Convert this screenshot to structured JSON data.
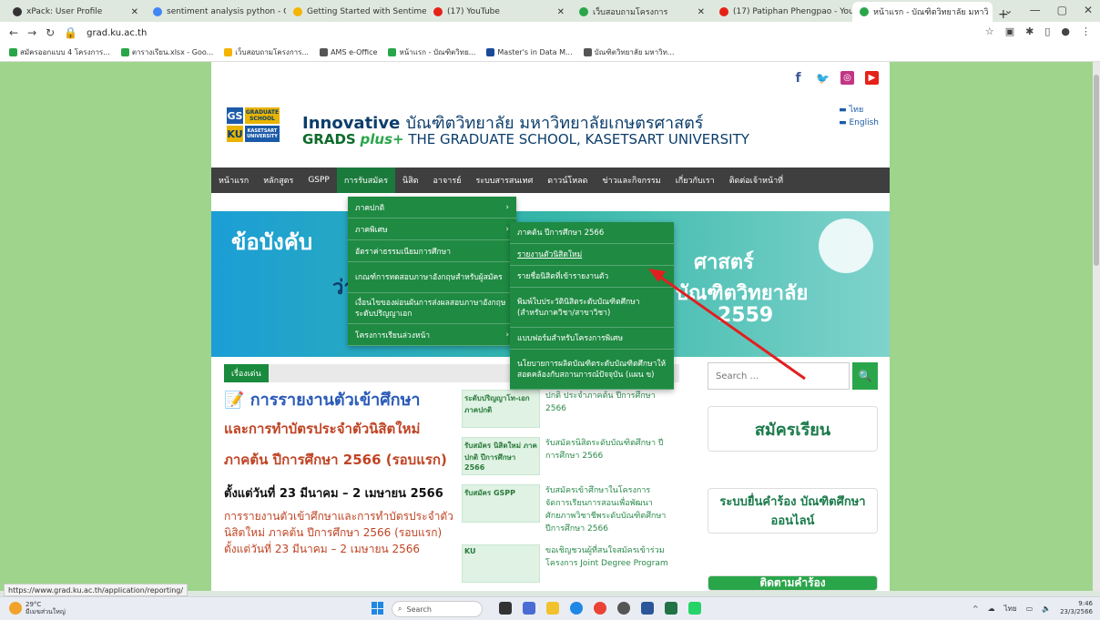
{
  "browser": {
    "tabs": [
      {
        "title": "xPack: User Profile",
        "color": "#333333",
        "active": false
      },
      {
        "title": "sentiment analysis python - Go",
        "color": "#4285f4",
        "active": false
      },
      {
        "title": "Getting Started with Sentiment",
        "color": "#f4b400",
        "active": false
      },
      {
        "title": "(17) YouTube",
        "color": "#e62117",
        "active": false
      },
      {
        "title": "เว็บสอบถามโครงการ",
        "color": "#2aa64a",
        "active": false
      },
      {
        "title": "(17) Patiphan Phengpao - YouTu",
        "color": "#e62117",
        "active": false
      },
      {
        "title": "หน้าแรก - บัณฑิตวิทยาลัย มหาวิ",
        "color": "#2aa64a",
        "active": true
      }
    ],
    "new_tab": "+",
    "window_controls": [
      "⌄",
      "—",
      "▢",
      "✕"
    ],
    "url": "grad.ku.ac.th",
    "bookmarks": [
      {
        "label": "สมัครออกแบบ 4 โครงการ...",
        "color": "#2aa64a"
      },
      {
        "label": "ตารางเรียน.xlsx - Goo...",
        "color": "#2aa64a"
      },
      {
        "label": "เว็บสอบถามโครงการ...",
        "color": "#f4b400"
      },
      {
        "label": "AMS e-Office",
        "color": "#555555"
      },
      {
        "label": "หน้าแรก - บัณฑิตวิทย...",
        "color": "#2aa64a"
      },
      {
        "label": "Master's in Data M...",
        "color": "#1a4a9a"
      },
      {
        "label": "บัณฑิตวิทยาลัย มหาวิท...",
        "color": "#555555"
      }
    ],
    "status_url": "https://www.grad.ku.ac.th/application/reporting/"
  },
  "site": {
    "social": [
      "f",
      "t",
      "ig",
      "▶"
    ],
    "logo": {
      "gs": "GS",
      "ku": "KU",
      "graduate": "GRADUATE SCHOOL",
      "kasetsart": "KASETSART UNIVERSITY"
    },
    "brand_en": "Innovative",
    "brand_th": "บัณฑิตวิทยาลัย มหาวิทยาลัยเกษตรศาสตร์",
    "brand_grads": "GRADS",
    "brand_plus": "plus+",
    "brand_sub": "THE GRADUATE SCHOOL, KASETSART UNIVERSITY",
    "lang": [
      "ไทย",
      "English"
    ],
    "nav": [
      "หน้าแรก",
      "หลักสูตร",
      "GSPP",
      "การรับสมัคร",
      "นิสิต",
      "อาจารย์",
      "ระบบสารสนเทศ",
      "ดาวน์โหลด",
      "ข่าวและกิจกรรม",
      "เกี่ยวกับเรา",
      "ติดต่อเจ้าหน้าที่"
    ],
    "banner": {
      "title": "ข้อบังคับ",
      "line2": "ว่าด้",
      "right1": "ศาสตร์",
      "right2": "บัณฑิตวิทยาลัย",
      "right3": "2559"
    },
    "dropdown1": [
      {
        "label": "ภาคปกติ",
        "arrow": "›"
      },
      {
        "label": "ภาคพิเศษ",
        "arrow": "›"
      },
      {
        "label": "อัตราค่าธรรมเนียมการศึกษา",
        "arrow": ""
      },
      {
        "label": "เกณฑ์การทดสอบภาษาอังกฤษสำหรับผู้สมัคร",
        "arrow": ""
      },
      {
        "label": "เงื่อนไขของผ่อนผันการส่งผลสอบภาษาอังกฤษ ระดับปริญญาเอก",
        "arrow": ""
      },
      {
        "label": "โครงการเรียนล่วงหน้า",
        "arrow": "›"
      }
    ],
    "dropdown2": [
      "ภาคต้น ปีการศึกษา 2566",
      "รายงานตัวนิสิตใหม่",
      "รายชื่อนิสิตที่เข้ารายงานตัว",
      "พิมพ์ใบประวัตินิสิตระดับบัณฑิตศึกษา (สำหรับภาควิชา/สาขาวิชา)",
      "แบบฟอร์มสำหรับโครงการพิเศษ",
      "นโยบายการผลิตบัณฑิตระดับบัณฑิตศึกษาให้สอดคล้องกับสถานการณ์ปัจจุบัน (แผน ข)"
    ],
    "news_label": "เรื่องเด่น",
    "news_icon": "☰",
    "main_news": {
      "h1": "การรายงานตัวเข้าศึกษา",
      "h2": "และการทำบัตรประจำตัวนิสิตใหม่",
      "h3": "ภาคต้น ปีการศึกษา 2566 (รอบแรก)",
      "date": "ตั้งแต่วันที่ 23 มีนาคม – 2 เมษายน 2566",
      "para": "การรายงานตัวเข้าศึกษาและการทำบัตรประจำตัวนิสิตใหม่ ภาคต้น ปีการศึกษา 2566 (รอบแรก) ตั้งแต่วันที่ 23 มีนาคม – 2 เมษายน 2566"
    },
    "mid_news": [
      {
        "thumb": "ระดับปริญญาโท-เอก ภาคปกติ",
        "text": "ปกติ ประจำภาคต้น ปีการศึกษา 2566"
      },
      {
        "thumb": "รับสมัคร นิสิตใหม่ ภาคปกติ ปีการศึกษา 2566",
        "text": "รับสมัครนิสิตระดับบัณฑิตศึกษา ปีการศึกษา 2566"
      },
      {
        "thumb": "รับสมัคร GSPP",
        "text": "รับสมัครเข้าศึกษาในโครงการจัดการเรียนการสอนเพื่อพัฒนาศักยภาพวิชาชีพระดับบัณฑิตศึกษา ปีการศึกษา 2566"
      },
      {
        "thumb": "KU",
        "text": "ขอเชิญชวนผู้ที่สนใจสมัครเข้าร่วมโครงการ Joint Degree Program"
      }
    ],
    "search_placeholder": "Search ...",
    "search_icon": "🔍",
    "side_buttons": [
      "สมัครเรียน",
      "ระบบยื่นคำร้อง บัณฑิตศึกษาออนไลน์",
      "ติดตามคำร้อง"
    ]
  },
  "taskbar": {
    "temp": "29°C",
    "weather_text": "มีเมฆส่วนใหญ่",
    "search": "Search",
    "lang": "ไทย",
    "time": "9:46",
    "date": "23/3/2566"
  },
  "colors": {
    "arrow": "#e02020",
    "accent": "#1f8a42",
    "nav": "#3f3f3f"
  }
}
